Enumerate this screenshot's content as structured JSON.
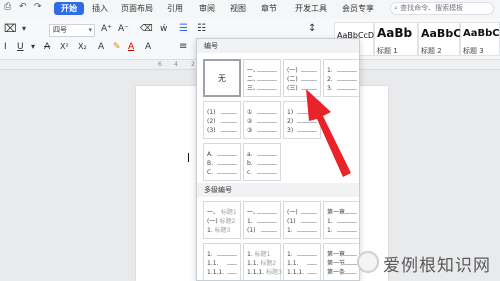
{
  "tabs": {
    "items": [
      "开始",
      "插入",
      "页面布局",
      "引用",
      "审阅",
      "视图",
      "章节",
      "开发工具",
      "会员专享"
    ],
    "search_placeholder": "查找命令、搜索模板"
  },
  "toolbar": {
    "font_size": "四号"
  },
  "styles": [
    {
      "sample": "AaBbCcDd",
      "name": "正文"
    },
    {
      "sample": "AaBb",
      "name": "标题 1"
    },
    {
      "sample": "AaBbC",
      "name": "标题 2"
    },
    {
      "sample": "AaBbC",
      "name": "标题 3"
    }
  ],
  "ruler": {
    "labels": [
      "6",
      "4",
      "2"
    ]
  },
  "dropdown": {
    "section_numbering": "编号",
    "section_multilevel": "多级编号",
    "none_label": "无",
    "single_level": [
      [
        "一、",
        "二、",
        "三、"
      ],
      [
        "(一)",
        "(二)",
        "(三)"
      ],
      [
        "1.",
        "2.",
        "3."
      ],
      [
        "(1)",
        "(2)",
        "(3)"
      ],
      [
        "①",
        "②",
        "③"
      ],
      [
        "1)",
        "2)",
        "3)"
      ],
      [
        "A.",
        "B.",
        "C."
      ],
      [
        "a.",
        "b.",
        "c."
      ]
    ],
    "multi_level": [
      [
        [
          "一、",
          "标题1"
        ],
        [
          "(一)",
          "标题2"
        ],
        [
          "1.",
          "标题3"
        ]
      ],
      [
        [
          "一、",
          ""
        ],
        [
          "1.",
          ""
        ],
        [
          "(1)",
          ""
        ]
      ],
      [
        [
          "(一)",
          ""
        ],
        [
          "(1)",
          ""
        ],
        [
          "1.",
          ""
        ]
      ],
      [
        [
          "第一章",
          ""
        ],
        [
          "1.",
          ""
        ],
        [
          "1.",
          ""
        ]
      ],
      [
        [
          "1.",
          ""
        ],
        [
          "1.1.",
          ""
        ],
        [
          "1.1.1.",
          ""
        ]
      ],
      [
        [
          "1.",
          "标题1"
        ],
        [
          "1.1.",
          "标题2"
        ],
        [
          "1.1.1.",
          "标题3"
        ]
      ],
      [
        [
          "1.",
          ""
        ],
        [
          "1.1.",
          ""
        ],
        [
          "1.1.1.",
          ""
        ]
      ],
      [
        [
          "第一章",
          ""
        ],
        [
          "第一节",
          ""
        ],
        [
          "第一条",
          ""
        ]
      ]
    ]
  },
  "watermark": {
    "text": "爱例根知识网"
  },
  "colors": {
    "accent": "#2f6ce6",
    "arrow": "#e8232a"
  }
}
